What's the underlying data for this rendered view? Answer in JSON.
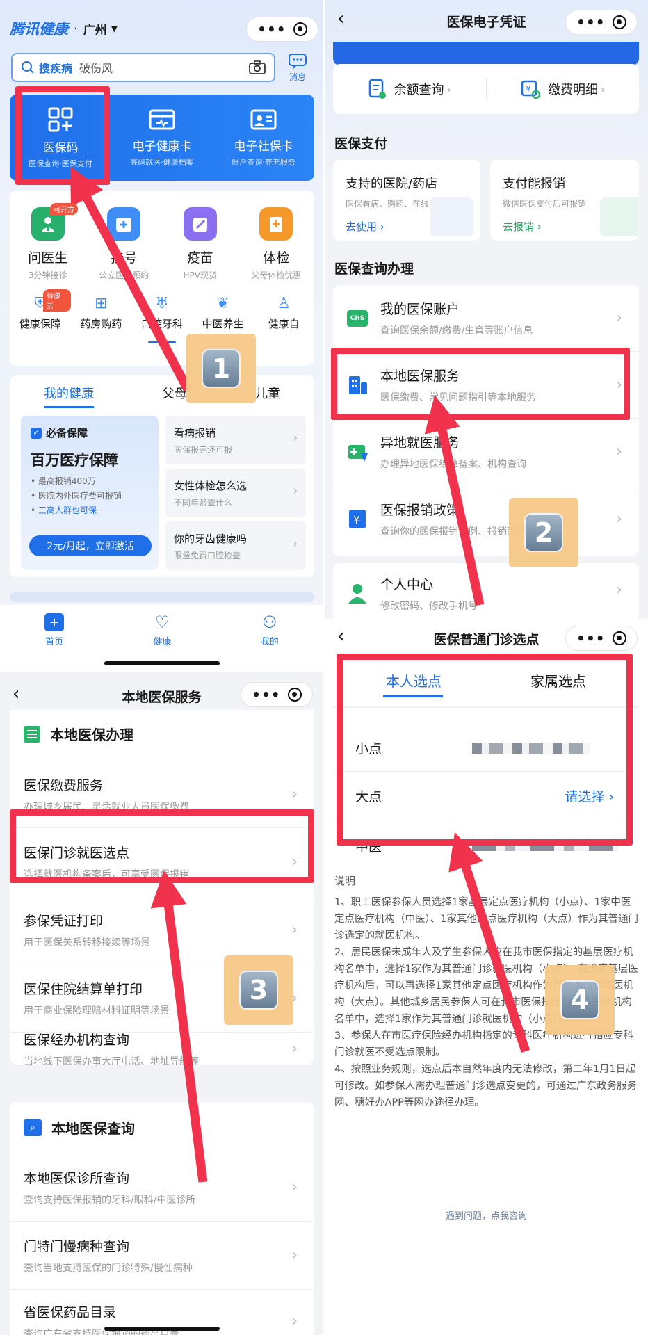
{
  "p1": {
    "brand": "腾讯健康",
    "brand_dot": "·",
    "city": "广州",
    "search_keyword": "搜疾病",
    "search_hint": "破伤风",
    "msg_label": "消息",
    "top_services": [
      {
        "title": "医保码",
        "sub": "医保查询·医保支付"
      },
      {
        "title": "电子健康卡",
        "sub": "亮码就医·健康档案"
      },
      {
        "title": "电子社保卡",
        "sub": "账户查询·养老服务"
      }
    ],
    "grid": [
      {
        "title": "问医生",
        "sub": "3分钟接诊",
        "badge": "可开方"
      },
      {
        "title": "挂号",
        "sub": "公立医院预约"
      },
      {
        "title": "疫苗",
        "sub": "HPV现货"
      },
      {
        "title": "体检",
        "sub": "父母体检优惠"
      }
    ],
    "small_items": [
      {
        "label": "健康保障",
        "badge": "待激活"
      },
      {
        "label": "药房购药"
      },
      {
        "label": "口腔牙科"
      },
      {
        "label": "中医养生"
      },
      {
        "label": "健康自"
      }
    ],
    "tabs": [
      "我的健康",
      "父母",
      "儿童"
    ],
    "promo": {
      "tag": "必备保障",
      "title": "百万医疗保障",
      "lines": [
        "最高报销400万",
        "医院内外医疗费可报销",
        "三高人群也可保"
      ],
      "cta": "2元/月起，立即激活"
    },
    "side_list": [
      {
        "title": "看病报销",
        "sub": "医保报完还可报"
      },
      {
        "title": "女性体检怎么选",
        "sub": "不同年龄查什么"
      },
      {
        "title": "你的牙齿健康吗",
        "sub": "限量免费口腔检查"
      }
    ],
    "bottom_nav": [
      "首页",
      "健康",
      "我的"
    ]
  },
  "p2": {
    "title": "医保电子凭证",
    "quick": [
      {
        "label": "余额查询"
      },
      {
        "label": "缴费明细"
      }
    ],
    "section_pay": "医保支付",
    "pay_cards": [
      {
        "title": "支持的医院/药店",
        "sub": "医保看病、购药、在线问诊",
        "link": "去使用"
      },
      {
        "title": "支付能报销",
        "sub": "微信医保支付后可报销",
        "link": "去报销"
      }
    ],
    "section_query": "医保查询办理",
    "list": [
      {
        "title": "我的医保账户",
        "sub": "查询医保余额/缴费/生育等账户信息",
        "icon_text": "CHS"
      },
      {
        "title": "本地医保服务",
        "sub": "医保缴费、常见问题指引等本地服务"
      },
      {
        "title": "异地就医服务",
        "sub": "办理异地医保结算备案、机构查询"
      },
      {
        "title": "医保报销政策",
        "sub": "查询你的医保报销比例、报销范围等"
      },
      {
        "title": "个人中心",
        "sub": "修改密码、修改手机号"
      }
    ]
  },
  "p3": {
    "title": "本地医保服务",
    "section1": "本地医保办理",
    "list1": [
      {
        "title": "医保缴费服务",
        "sub": "办理城乡居民、灵活就业人员医保缴费"
      },
      {
        "title": "医保门诊就医选点",
        "sub": "选择就医机构备案后，可享受医保报销"
      },
      {
        "title": "参保凭证打印",
        "sub": "用于医保关系转移接续等场景"
      },
      {
        "title": "医保住院结算单打印",
        "sub": "用于商业保险理赔材料证明等场景"
      },
      {
        "title": "医保经办机构查询",
        "sub": "当地线下医保办事大厅电话、地址导航等"
      }
    ],
    "section2": "本地医保查询",
    "list2": [
      {
        "title": "本地医保诊所查询",
        "sub": "查询支持医保报销的牙科/眼科/中医诊所"
      },
      {
        "title": "门特门慢病种查询",
        "sub": "查询当地支持医保的门诊特殊/慢性病种"
      },
      {
        "title": "省医保药品目录",
        "sub": "查询广东省支持医保报销的药品目录"
      }
    ]
  },
  "p4": {
    "title": "医保普通门诊选点",
    "tabs": [
      "本人选点",
      "家属选点"
    ],
    "rows": [
      {
        "label": "小点",
        "value": ""
      },
      {
        "label": "大点",
        "value": "请选择"
      },
      {
        "label": "中医",
        "value": ""
      }
    ],
    "note_title": "说明",
    "notes": [
      "1、职工医保参保人员选择1家基层定点医疗机构（小点）、1家中医定点医疗机构（中医）、1家其他定点医疗机构（大点）作为其普通门诊选定的就医机构。",
      "2、居民医保未成年人及学生参保人应在我市医保指定的基层医疗机构名单中，选择1家作为其普通门诊就医机构（小点），在选定基层医疗机构后，可以再选择1家其他定点医疗机构作为其普通门诊就医机构（大点）。其他城乡居民参保人可在我市医保指定的基层医疗机构名单中，选择1家作为其普通门诊就医机构（小点）。",
      "3、参保人在市医疗保险经办机构指定的专科医疗机构进行相应专科门诊就医不受选点限制。",
      "4、按照业务规则，选点后本自然年度内无法修改，第二年1月1日起可修改。如参保人需办理普通门诊选点变更的，可通过广东政务服务网、穗好办APP等网办途径办理。"
    ],
    "footer": "遇到问题，点我咨询"
  },
  "steps": [
    "1",
    "2",
    "3",
    "4"
  ],
  "colors": {
    "accent": "#1e6fe8",
    "red": "#f0324c",
    "badge": "#f6c987"
  }
}
